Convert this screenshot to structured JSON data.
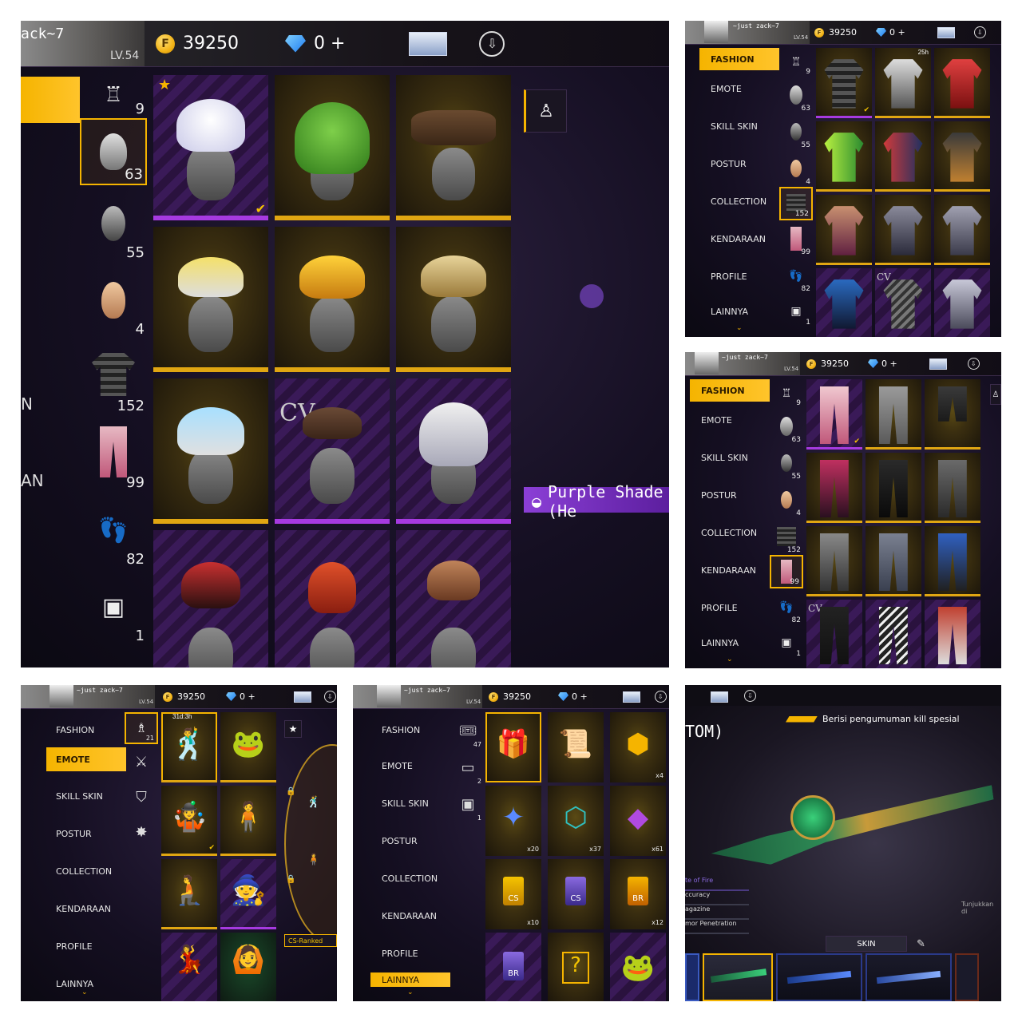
{
  "player": {
    "name": "~just zack~7",
    "name_large": "ack~7",
    "level": "LV.54"
  },
  "currency": {
    "coins": "39250",
    "diamonds": "0 +"
  },
  "menu": [
    "FASHION",
    "EMOTE",
    "SKILL SKIN",
    "POSTUR",
    "COLLECTION",
    "KENDARAAN",
    "PROFILE",
    "LAINNYA"
  ],
  "panel1": {
    "side_fragments": [
      "N",
      "AN"
    ],
    "categories": [
      {
        "icon": "shirt-icon",
        "count": "9"
      },
      {
        "icon": "head-icon",
        "count": "63"
      },
      {
        "icon": "mask-icon",
        "count": "55"
      },
      {
        "icon": "face-icon",
        "count": "4"
      },
      {
        "icon": "top-icon",
        "count": "152"
      },
      {
        "icon": "pants-icon",
        "count": "99"
      },
      {
        "icon": "shoes-icon",
        "count": "82"
      },
      {
        "icon": "box-icon",
        "count": "1"
      }
    ],
    "tooltip": "Purple Shade (He"
  },
  "panel2": {
    "categories": [
      "9",
      "63",
      "55",
      "4",
      "152",
      "99",
      "82",
      "1"
    ],
    "badge": "25h"
  },
  "panel3": {
    "categories": [
      "9",
      "63",
      "55",
      "4",
      "152",
      "99",
      "82",
      "1"
    ]
  },
  "panel4": {
    "count": "21",
    "badge": "31d:3h",
    "ranked": "CS-Ranked"
  },
  "panel5": {
    "categories": [
      "47",
      "2",
      "1"
    ],
    "quantities": [
      "x4",
      "x20",
      "x37",
      "x61",
      "x10",
      "x12"
    ],
    "labels": [
      "CS",
      "CS",
      "BR",
      "BR"
    ]
  },
  "panel6": {
    "title_fragment": "TOM)",
    "announce": "Berisi pengumuman kill spesial",
    "stats": [
      "te of Fire",
      "ccuracy",
      "agazine",
      "mor Penetration"
    ],
    "hint": "Tunjukkan di",
    "skin_tab": "SKIN"
  },
  "colors": {
    "accent": "#f5b400",
    "purple": "#a63ae0",
    "bg": "#150f22"
  }
}
